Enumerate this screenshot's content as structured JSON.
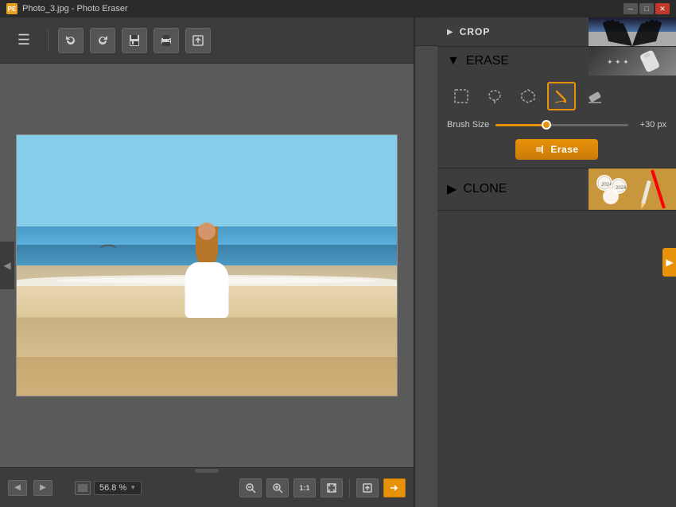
{
  "window": {
    "title": "Photo_3.jpg - Photo Eraser",
    "icon_label": "PE"
  },
  "titlebar": {
    "minimize_label": "─",
    "maximize_label": "□",
    "close_label": "✕"
  },
  "toolbar": {
    "menu_label": "☰",
    "undo_label": "↩",
    "redo_label": "↪",
    "save_label": "💾",
    "print_label": "🖨",
    "export_label": "↗"
  },
  "statusbar": {
    "nav_left_label": "◀",
    "nav_right_label": "▶",
    "zoom_value": "56.8 %",
    "zoom_arrow": "▼",
    "zoom_out_label": "🔍",
    "zoom_in_label": "🔍",
    "reset_zoom_label": "1:1",
    "fit_label": "⛶",
    "export2_label": "↑",
    "finish_label": "→"
  },
  "panel": {
    "crop_label": "CROP",
    "erase_label": "ERASE",
    "clone_label": "CLONE",
    "brush_size_label": "Brush Size",
    "brush_value": "+30 px",
    "erase_button_label": "Erase",
    "eraser_icon": "✏",
    "tools": [
      {
        "name": "rect-select",
        "label": "□"
      },
      {
        "name": "lasso-select",
        "label": "⊙"
      },
      {
        "name": "poly-lasso",
        "label": "⬡"
      },
      {
        "name": "brush-tool",
        "label": "✏",
        "active": true
      },
      {
        "name": "eraser-tool",
        "label": "⌫"
      }
    ],
    "arrow_label": "▶"
  }
}
